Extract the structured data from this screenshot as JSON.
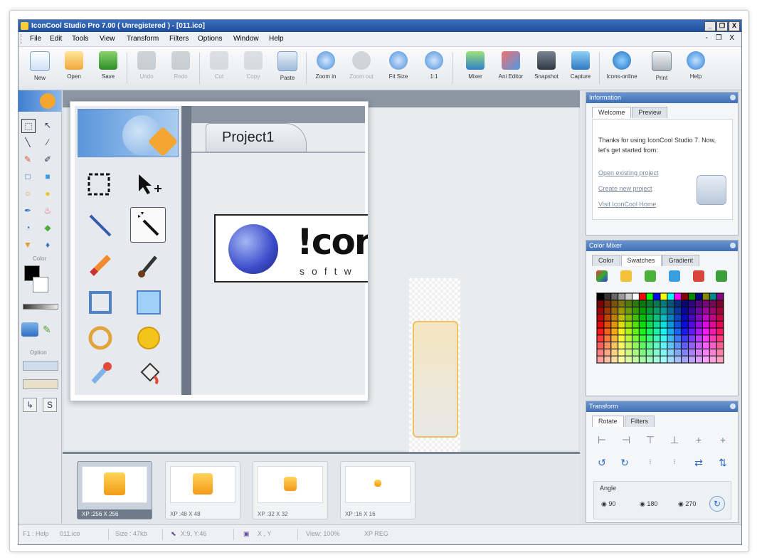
{
  "window": {
    "title": "IconCool Studio Pro 7.00 ( Unregistered ) - [011.ico]",
    "controls": [
      "_",
      "❐",
      "X"
    ],
    "mdi_controls": "- ❐ X"
  },
  "menu": [
    "File",
    "Edit",
    "Tools",
    "View",
    "Transform",
    "Filters",
    "Options",
    "Window",
    "Help"
  ],
  "toolbar": [
    {
      "label": "New",
      "icon": "new-file-icon"
    },
    {
      "label": "Open",
      "icon": "open-folder-icon"
    },
    {
      "label": "Save",
      "icon": "save-icon"
    },
    {
      "label": "Undo",
      "icon": "undo-icon",
      "disabled": true
    },
    {
      "label": "Redo",
      "icon": "redo-icon",
      "disabled": true
    },
    {
      "label": "Cut",
      "icon": "cut-icon",
      "disabled": true
    },
    {
      "label": "Copy",
      "icon": "copy-icon",
      "disabled": true
    },
    {
      "label": "Paste",
      "icon": "paste-icon"
    },
    {
      "label": "Zoom in",
      "icon": "zoom-in-icon"
    },
    {
      "label": "Zoom out",
      "icon": "zoom-out-icon",
      "disabled": true
    },
    {
      "label": "Fit Size",
      "icon": "fit-size-icon"
    },
    {
      "label": "1:1",
      "icon": "actual-size-icon"
    },
    {
      "label": "Mixer",
      "icon": "mixer-icon"
    },
    {
      "label": "Ani Editor",
      "icon": "ani-editor-icon"
    },
    {
      "label": "Snapshot",
      "icon": "snapshot-icon"
    },
    {
      "label": "Capture",
      "icon": "capture-icon"
    },
    {
      "label": "Icons-online",
      "icon": "icons-online-icon"
    },
    {
      "label": "Print",
      "icon": "print-icon"
    },
    {
      "label": "Help",
      "icon": "help-icon"
    }
  ],
  "left_panel": {
    "color_label": "Color",
    "option_label": "Option",
    "s_label": "S"
  },
  "zoom": {
    "project_tab": "Project1",
    "logo_word": "!conc",
    "logo_sub": "softw"
  },
  "thumbnails": [
    {
      "label": "XP :256 X 256",
      "selected": true
    },
    {
      "label": "XP :48 X 48"
    },
    {
      "label": "XP :32 X 32"
    },
    {
      "label": "XP :16 X 16"
    }
  ],
  "info_panel": {
    "title": "Information",
    "tabs": [
      "Welcome",
      "Preview"
    ],
    "text": "Thanks for using IconCool Studio 7. Now, let's get started from:",
    "links": [
      "Open existing project",
      "Create new project",
      "Visit IconCool Home"
    ]
  },
  "color_mixer": {
    "title": "Color Mixer",
    "tabs": [
      "Color",
      "Swatches",
      "Gradient"
    ]
  },
  "transform": {
    "title": "Transform",
    "tabs": [
      "Rotate",
      "Filters"
    ],
    "angle_label": "Angle",
    "angles": [
      "90",
      "180",
      "270"
    ]
  },
  "status": {
    "help": "F1 : Help",
    "file": "011.ico",
    "size": "Size : 47kb",
    "xy": "X:9, Y:46",
    "xy2": "X , Y",
    "view": "View: 100%",
    "mode": "XP REG"
  },
  "colors": {
    "title_bar": "#2a5ba8",
    "panel_head": "#4f7fc1",
    "accent_orange": "#f3a632"
  }
}
